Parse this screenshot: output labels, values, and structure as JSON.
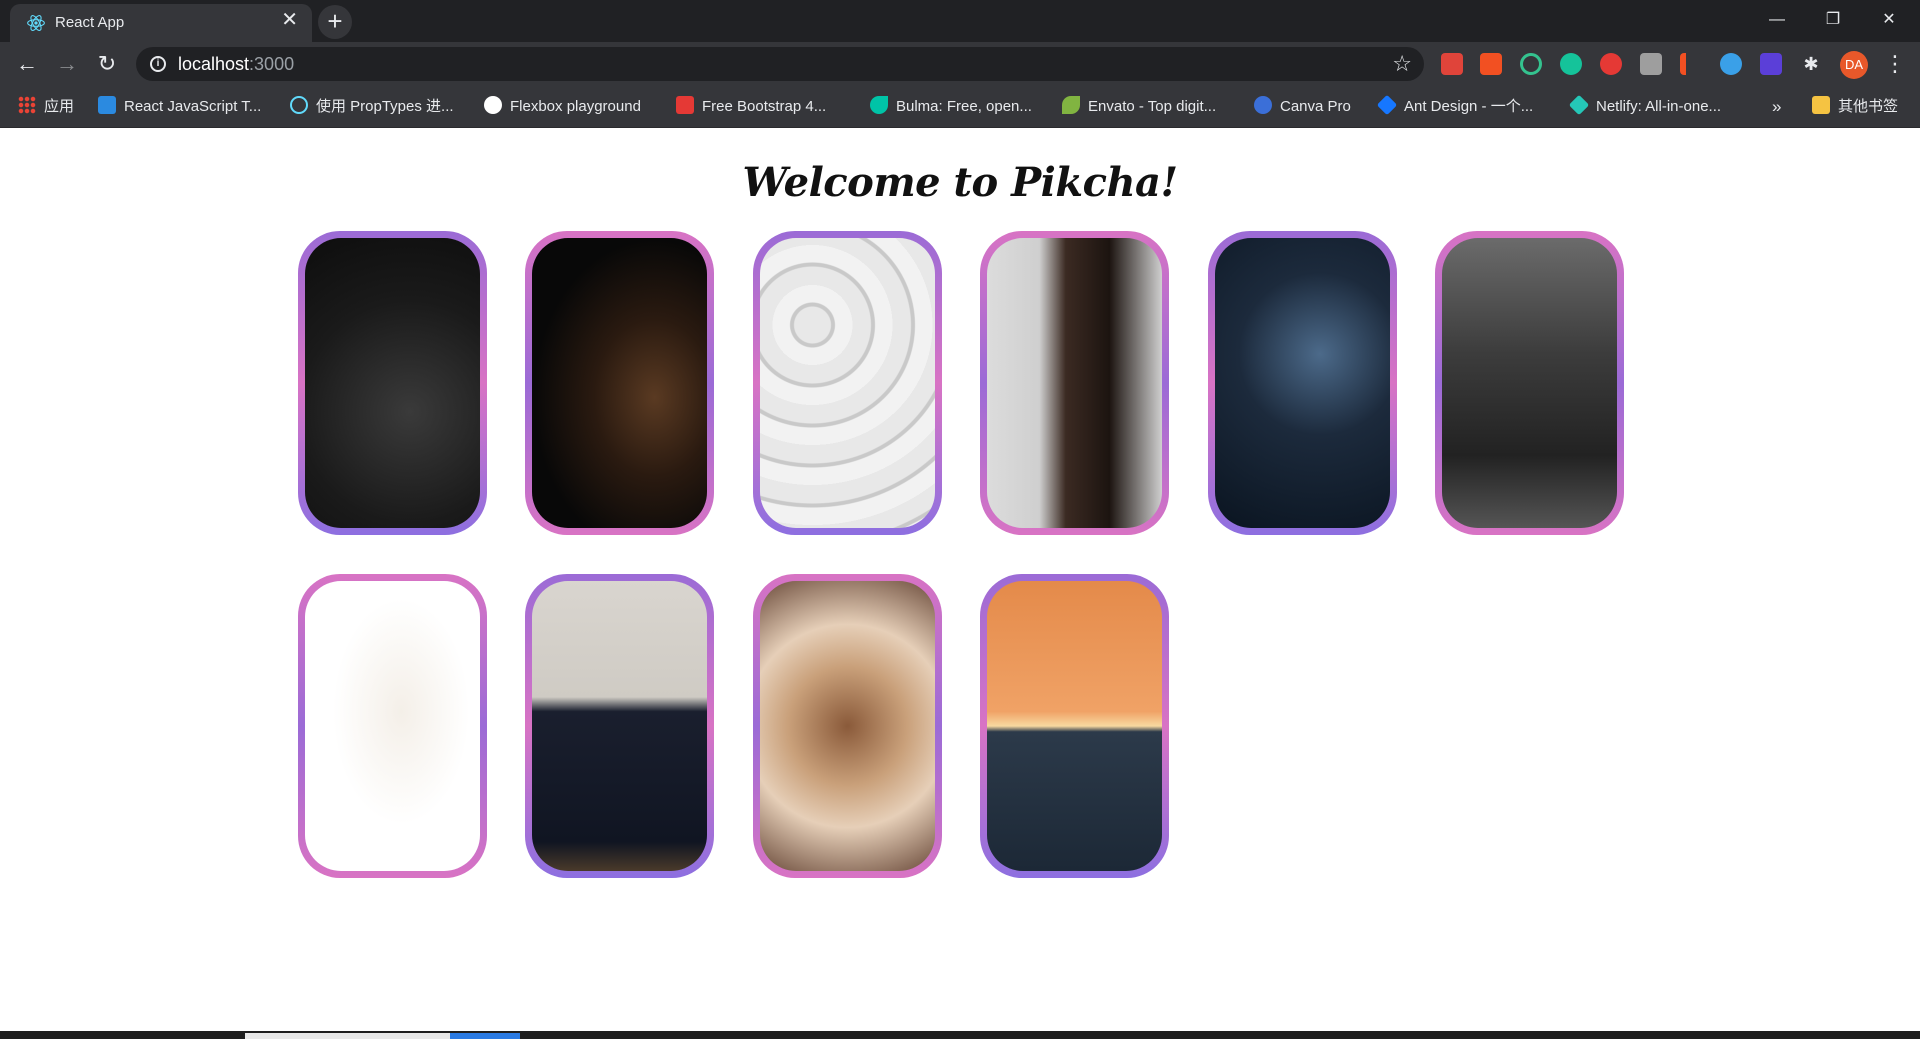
{
  "browser": {
    "tab_title": "React App",
    "tab_close": "✕",
    "new_tab": "+",
    "window_controls": {
      "minimize": "—",
      "restore": "❐",
      "close": "✕"
    },
    "nav": {
      "back": "←",
      "forward": "→",
      "reload": "↻"
    },
    "url_host": "localhost",
    "url_port": ":3000",
    "profile_initials": "DA",
    "menu": "⋮",
    "bookmarks_overflow": "»",
    "bookmarks": [
      {
        "label": "应用",
        "icon": "apps-grid-icon"
      },
      {
        "label": "React JavaScript T...",
        "icon": "vscode-icon",
        "color": "#2b8ae0"
      },
      {
        "label": "使用 PropTypes 进...",
        "icon": "react-icon",
        "color": "#61dafb"
      },
      {
        "label": "Flexbox playground",
        "icon": "flexbox-icon",
        "color": "#ffffff"
      },
      {
        "label": "Free Bootstrap 4...",
        "icon": "bootstrap-s-icon",
        "color": "#e53935"
      },
      {
        "label": "Bulma: Free, open...",
        "icon": "bulma-icon",
        "color": "#00c4a7"
      },
      {
        "label": "Envato - Top digit...",
        "icon": "envato-leaf-icon",
        "color": "#81b441"
      },
      {
        "label": "Canva Pro",
        "icon": "canva-icon",
        "color": "#3b6fd8"
      },
      {
        "label": "Ant Design - 一个...",
        "icon": "ant-design-icon",
        "color": "#1677ff"
      },
      {
        "label": "Netlify: All-in-one...",
        "icon": "netlify-icon",
        "color": "#25c7b7"
      },
      {
        "label": "其他书签",
        "icon": "folder-icon",
        "color": "#f5c342"
      }
    ]
  },
  "page": {
    "heading": "Welcome to Pikcha!",
    "images": [
      {
        "name": "image-dark-camera-gear"
      },
      {
        "name": "image-person-in-shadow"
      },
      {
        "name": "image-silver-ornaments"
      },
      {
        "name": "image-portrait-man"
      },
      {
        "name": "image-city-night"
      },
      {
        "name": "image-woman-with-mask"
      },
      {
        "name": "image-white-swan"
      },
      {
        "name": "image-pampas-kitchen"
      },
      {
        "name": "image-woman-with-dog"
      },
      {
        "name": "image-ocean-sunset"
      }
    ]
  }
}
